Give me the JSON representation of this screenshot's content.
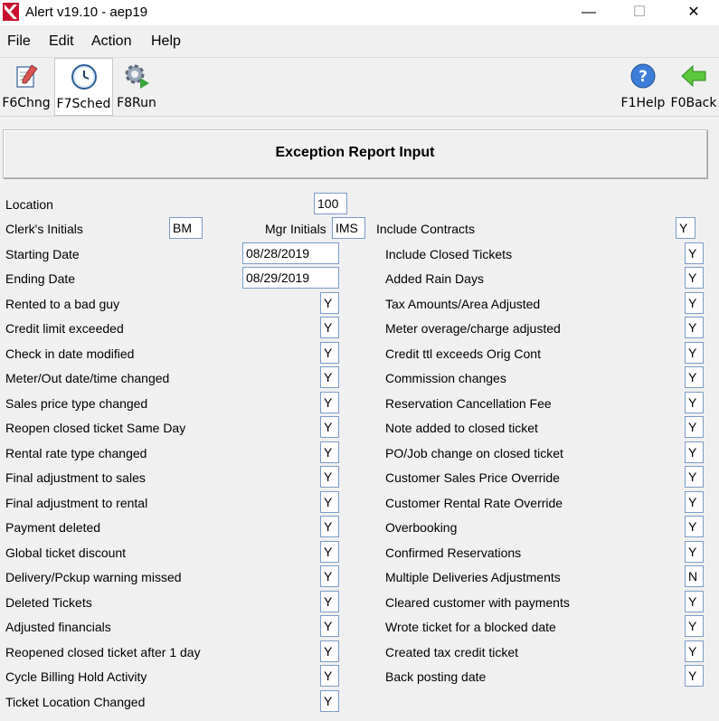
{
  "window": {
    "title": "Alert v19.10 - aep19",
    "minimize": "—",
    "maximize": "☐",
    "close": "✕"
  },
  "menu": [
    "File",
    "Edit",
    "Action",
    "Help"
  ],
  "toolbar": {
    "change": "F6Chng",
    "schedule": "F7Sched",
    "run": "F8Run",
    "help": "F1Help",
    "back": "F0Back"
  },
  "form": {
    "title": "Exception Report Input",
    "location": {
      "label": "Location",
      "value": "100"
    },
    "clerk_initials": {
      "label": "Clerk's Initials",
      "value": "BM"
    },
    "mgr_initials": {
      "label": "Mgr Initials",
      "value": "IMS"
    },
    "include_contracts": {
      "label": "Include Contracts",
      "value": "Y"
    },
    "starting_date": {
      "label": "Starting Date",
      "value": "08/28/2019"
    },
    "ending_date": {
      "label": "Ending Date",
      "value": "08/29/2019"
    },
    "left_options": [
      {
        "label": "Rented to a bad guy",
        "value": "Y"
      },
      {
        "label": "Credit limit exceeded",
        "value": "Y"
      },
      {
        "label": "Check in date modified",
        "value": "Y"
      },
      {
        "label": "Meter/Out date/time changed",
        "value": "Y"
      },
      {
        "label": "Sales price type changed",
        "value": "Y"
      },
      {
        "label": "Reopen closed ticket Same Day",
        "value": "Y"
      },
      {
        "label": "Rental rate type changed",
        "value": "Y"
      },
      {
        "label": "Final adjustment to sales",
        "value": "Y"
      },
      {
        "label": "Final adjustment to rental",
        "value": "Y"
      },
      {
        "label": "Payment deleted",
        "value": "Y"
      },
      {
        "label": "Global ticket discount",
        "value": "Y"
      },
      {
        "label": "Delivery/Pckup warning missed",
        "value": "Y"
      },
      {
        "label": "Deleted Tickets",
        "value": "Y"
      },
      {
        "label": "Adjusted financials",
        "value": "Y"
      },
      {
        "label": "Reopened closed ticket after 1 day",
        "value": "Y"
      },
      {
        "label": "Cycle Billing Hold Activity",
        "value": "Y"
      },
      {
        "label": "Ticket Location Changed",
        "value": "Y"
      }
    ],
    "right_options": [
      {
        "label": "Include Closed Tickets",
        "value": "Y"
      },
      {
        "label": "Added Rain Days",
        "value": "Y"
      },
      {
        "label": "Tax Amounts/Area Adjusted",
        "value": "Y"
      },
      {
        "label": "Meter overage/charge adjusted",
        "value": "Y"
      },
      {
        "label": "Credit ttl exceeds Orig Cont",
        "value": "Y"
      },
      {
        "label": "Commission changes",
        "value": "Y"
      },
      {
        "label": "Reservation Cancellation Fee",
        "value": "Y"
      },
      {
        "label": "Note added to closed ticket",
        "value": "Y"
      },
      {
        "label": "PO/Job change on closed ticket",
        "value": "Y"
      },
      {
        "label": "Customer Sales Price Override",
        "value": "Y"
      },
      {
        "label": "Customer Rental Rate Override",
        "value": "Y"
      },
      {
        "label": "Overbooking",
        "value": "Y"
      },
      {
        "label": "Confirmed Reservations",
        "value": "Y"
      },
      {
        "label": "Multiple Deliveries Adjustments",
        "value": "N"
      },
      {
        "label": "Cleared customer with payments",
        "value": "Y"
      },
      {
        "label": "Wrote ticket for a blocked date",
        "value": "Y"
      },
      {
        "label": "Created tax credit ticket",
        "value": "Y"
      },
      {
        "label": "Back posting date",
        "value": "Y"
      }
    ]
  }
}
